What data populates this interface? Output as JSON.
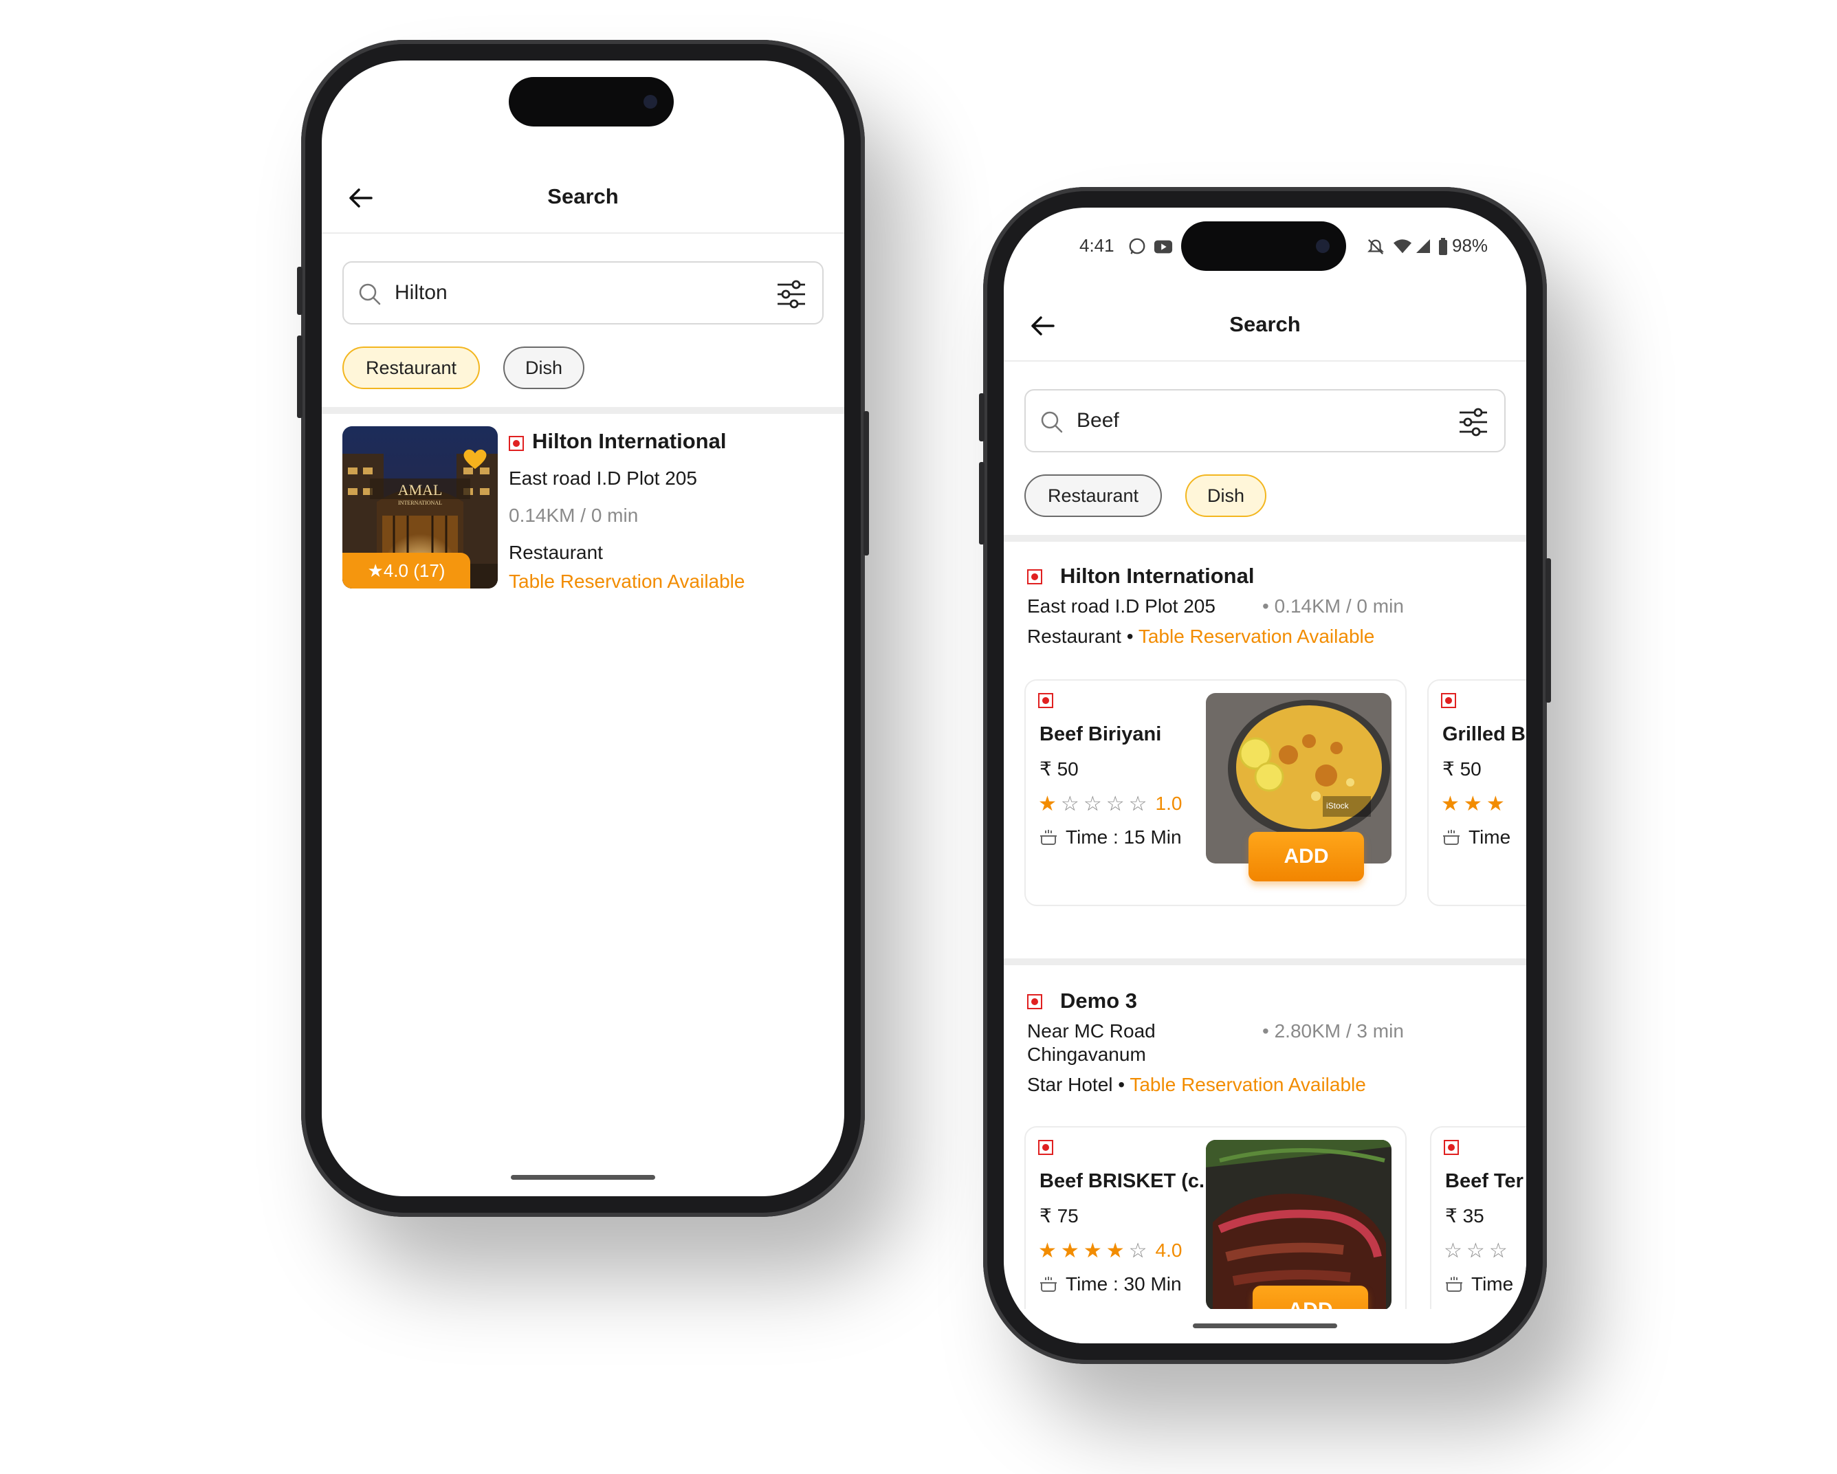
{
  "phone_left": {
    "header": {
      "title": "Search"
    },
    "search": {
      "value": "Hilton"
    },
    "chips": [
      {
        "label": "Restaurant",
        "active": true
      },
      {
        "label": "Dish",
        "active": false
      }
    ],
    "result": {
      "name": "Hilton International",
      "address": "East road I.D Plot 205",
      "distance": "0.14KM / 0 min",
      "category": "Restaurant",
      "reservation": "Table Reservation Available",
      "rating_badge": "4.0 (17)",
      "image_brand": "AMAL",
      "image_sub": "INTERNATIONAL"
    }
  },
  "phone_right": {
    "status_bar": {
      "time": "4:41",
      "battery": "98%"
    },
    "header": {
      "title": "Search"
    },
    "search": {
      "value": "Beef"
    },
    "chips": [
      {
        "label": "Restaurant",
        "active": false
      },
      {
        "label": "Dish",
        "active": true
      }
    ],
    "restaurants": [
      {
        "name": "Hilton International",
        "address": "East road I.D Plot 205",
        "distance": "0.14KM / 0 min",
        "category": "Restaurant",
        "reservation": "Table Reservation Available",
        "dishes": [
          {
            "name": "Beef Biriyani",
            "price": "₹ 50",
            "rating": 1,
            "rating_text": "1.0",
            "time": "Time : 15 Min",
            "add_label": "ADD",
            "image_tag": "iStock"
          },
          {
            "name": "Grilled B",
            "price": "₹ 50",
            "rating": 3,
            "time": "Time"
          }
        ]
      },
      {
        "name": "Demo 3",
        "address_line1": "Near MC Road",
        "address_line2": "Chingavanum",
        "distance": "2.80KM / 3 min",
        "category": "Star Hotel",
        "reservation": "Table Reservation Available",
        "dishes": [
          {
            "name": "Beef BRISKET (c...",
            "price": "₹ 75",
            "rating": 4,
            "rating_text": "4.0",
            "time": "Time : 30 Min",
            "add_label": "ADD"
          },
          {
            "name": "Beef Ter",
            "price": "₹ 35",
            "rating": 0,
            "time": "Time"
          }
        ]
      }
    ]
  },
  "colors": {
    "accent": "#f28c00",
    "chip_active_border": "#f3b61f",
    "veg_red": "#e02020"
  }
}
